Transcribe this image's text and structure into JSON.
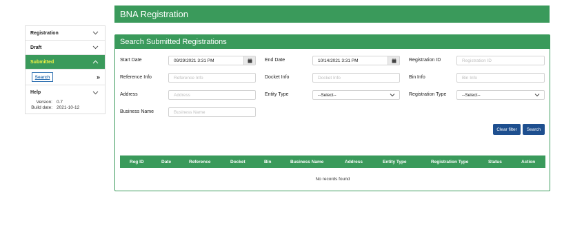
{
  "app": {
    "title": "BNA Registration"
  },
  "sidebar": {
    "items": [
      {
        "label": "Registration",
        "chevron": "chevron-down"
      },
      {
        "label": "Draft",
        "chevron": "chevron-down"
      },
      {
        "label": "Submitted",
        "chevron": "chevron-up",
        "active": true
      },
      {
        "label": "Help",
        "chevron": "chevron-down"
      }
    ],
    "submitted_sub": {
      "search_label": "Search",
      "collapse_glyph": "»"
    },
    "version_label": "Version:",
    "version_value": "0.7",
    "build_label": "Build date:",
    "build_value": "2021-10-12"
  },
  "panel": {
    "title": "Search Submitted Registrations",
    "fields": {
      "start_date": {
        "label": "Start Date",
        "value": "09/29/2021 3:31 PM"
      },
      "end_date": {
        "label": "End Date",
        "value": "10/14/2021 3:31 PM"
      },
      "registration_id": {
        "label": "Registration ID",
        "placeholder": "Registration ID"
      },
      "reference_info": {
        "label": "Reference Info",
        "placeholder": "Reference Info"
      },
      "docket_info": {
        "label": "Docket Info",
        "placeholder": "Docket Info"
      },
      "bin_info": {
        "label": "Bin Info",
        "placeholder": "Bin Info"
      },
      "address": {
        "label": "Address",
        "placeholder": "Address"
      },
      "entity_type": {
        "label": "Entity Type",
        "value": "--Select--"
      },
      "registration_type": {
        "label": "Registration Type",
        "value": "--Select--"
      },
      "business_name": {
        "label": "Business Name",
        "placeholder": "Business Name"
      }
    },
    "buttons": {
      "clear_filter": "Clear filter",
      "search": "Search"
    },
    "table": {
      "columns": [
        "Reg ID",
        "Date",
        "Reference",
        "Docket",
        "Bin",
        "Business Name",
        "Address",
        "Entity Type",
        "Registration Type",
        "Status",
        "Action"
      ],
      "empty_message": "No records found"
    }
  },
  "colors": {
    "brand_green": "#3a9a5b",
    "button_blue": "#1e4f8f",
    "active_text": "#f5f545"
  }
}
